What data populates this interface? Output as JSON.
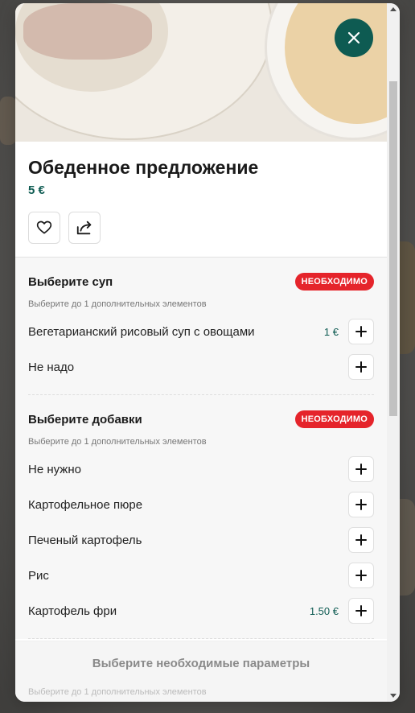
{
  "product": {
    "title": "Обеденное предложение",
    "price": "5 €"
  },
  "icons": {
    "close": "close-icon",
    "favorite": "heart-icon",
    "share": "share-icon",
    "add": "plus-icon"
  },
  "colors": {
    "accent": "#0e5b52",
    "required_badge": "#e5242b"
  },
  "groups": [
    {
      "title": "Выберите суп",
      "badge": "НЕОБХОДИМО",
      "subtitle": "Выберите до 1 дополнительных элементов",
      "items": [
        {
          "label": "Вегетарианский рисовый суп с овощами",
          "price": "1 €"
        },
        {
          "label": "Не надо",
          "price": ""
        }
      ]
    },
    {
      "title": "Выберите добавки",
      "badge": "НЕОБХОДИМО",
      "subtitle": "Выберите до 1 дополнительных элементов",
      "items": [
        {
          "label": "Не нужно",
          "price": ""
        },
        {
          "label": "Картофельное пюре",
          "price": ""
        },
        {
          "label": "Печеный картофель",
          "price": ""
        },
        {
          "label": "Рис",
          "price": ""
        },
        {
          "label": "Картофель фри",
          "price": "1.50 €"
        }
      ]
    }
  ],
  "footer": {
    "button_label": "Выберите необходимые параметры",
    "peek_text": "Выберите до 1 дополнительных элементов"
  }
}
